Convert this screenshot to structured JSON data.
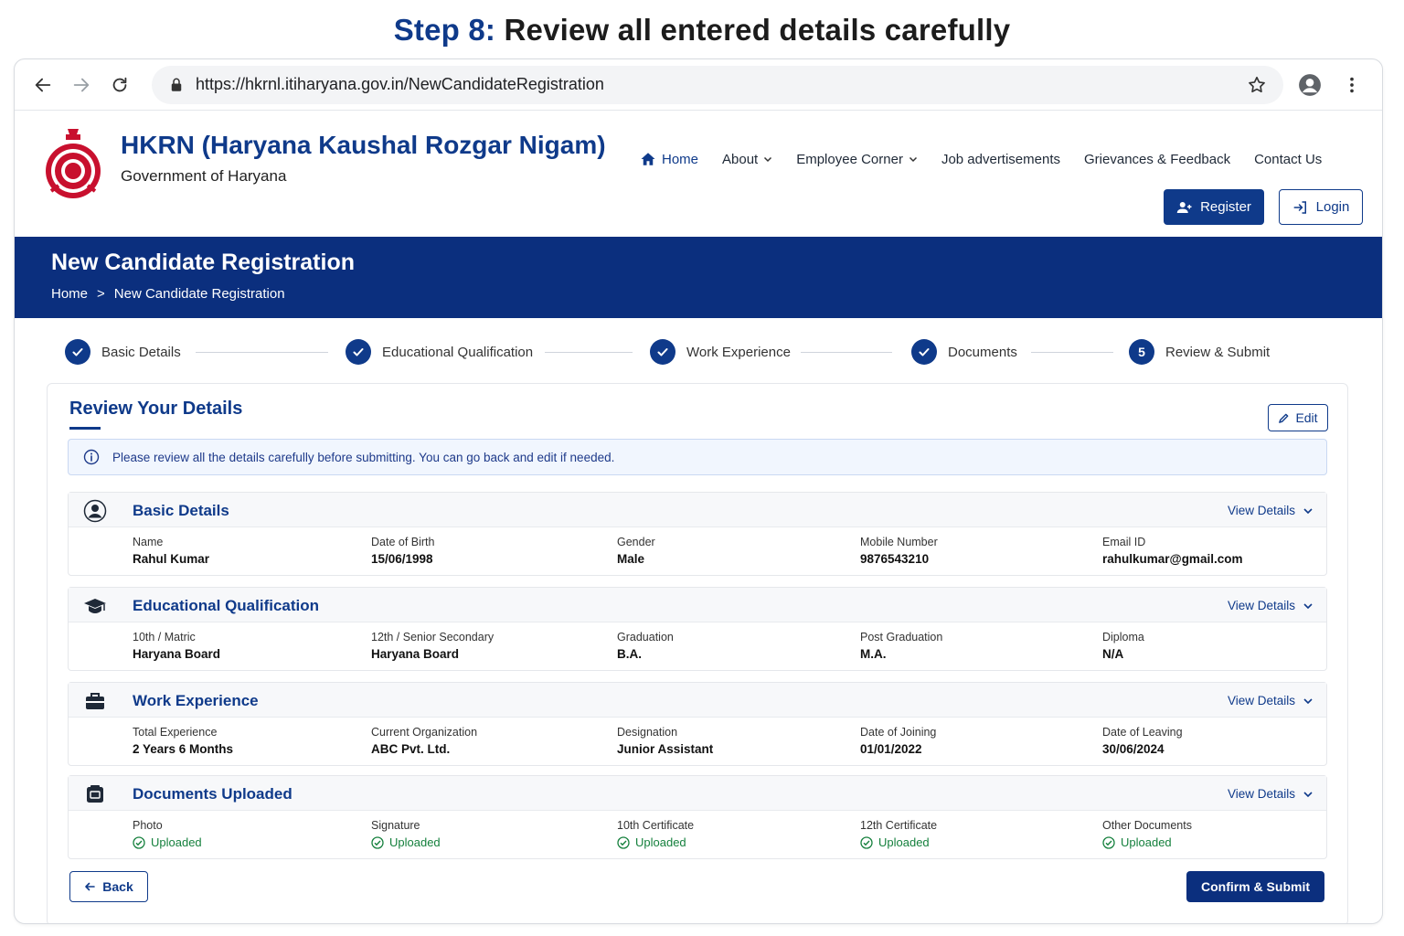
{
  "heading": {
    "step": "Step 8:",
    "text": "Review all entered details carefully"
  },
  "browser": {
    "url": "https://hkrnl.itiharyana.gov.in/NewCandidateRegistration"
  },
  "site": {
    "title": "HKRN (Haryana Kaushal Rozgar Nigam)",
    "subtitle": "Government of Haryana",
    "nav": [
      "Home",
      "About",
      "Employee Corner",
      "Job advertisements",
      "Grievances & Feedback",
      "Contact Us"
    ],
    "register_label": "Register",
    "login_label": "Login"
  },
  "banner": {
    "title": "New Candidate Registration",
    "breadcrumb": [
      "Home",
      ">",
      "New Candidate Registration"
    ]
  },
  "stepper": {
    "steps": [
      "Basic Details",
      "Educational Qualification",
      "Work Experience",
      "Documents",
      "Review & Submit"
    ],
    "current_number": "5"
  },
  "review": {
    "title": "Review Your Details",
    "edit_label": "Edit",
    "info": "Please review all the details carefully before submitting. You can go back and edit if needed.",
    "view_details_label": "View Details",
    "sections": {
      "basic": {
        "title": "Basic Details",
        "fields": [
          {
            "label": "Name",
            "value": "Rahul Kumar"
          },
          {
            "label": "Date of Birth",
            "value": "15/06/1998"
          },
          {
            "label": "Gender",
            "value": "Male"
          },
          {
            "label": "Mobile Number",
            "value": "9876543210"
          },
          {
            "label": "Email ID",
            "value": "rahulkumar@gmail.com"
          }
        ]
      },
      "education": {
        "title": "Educational Qualification",
        "fields": [
          {
            "label": "10th / Matric",
            "value": "Haryana Board"
          },
          {
            "label": "12th / Senior Secondary",
            "value": "Haryana Board"
          },
          {
            "label": "Graduation",
            "value": "B.A."
          },
          {
            "label": "Post Graduation",
            "value": "M.A."
          },
          {
            "label": "Diploma",
            "value": "N/A"
          }
        ]
      },
      "work": {
        "title": "Work Experience",
        "fields": [
          {
            "label": "Total Experience",
            "value": "2 Years 6 Months"
          },
          {
            "label": "Current Organization",
            "value": "ABC Pvt. Ltd."
          },
          {
            "label": "Designation",
            "value": "Junior Assistant"
          },
          {
            "label": "Date of Joining",
            "value": "01/01/2022"
          },
          {
            "label": "Date of Leaving",
            "value": "30/06/2024"
          }
        ]
      },
      "documents": {
        "title": "Documents Uploaded",
        "fields": [
          {
            "label": "Photo",
            "value": "Uploaded"
          },
          {
            "label": "Signature",
            "value": "Uploaded"
          },
          {
            "label": "10th Certificate",
            "value": "Uploaded"
          },
          {
            "label": "12th Certificate",
            "value": "Uploaded"
          },
          {
            "label": "Other Documents",
            "value": "Uploaded"
          }
        ]
      }
    },
    "back_label": "Back",
    "submit_label": "Confirm & Submit"
  },
  "colors": {
    "primary": "#0f3a8a",
    "banner": "#0b2f7e",
    "success": "#15803d",
    "info_bg": "#f1f6fe"
  },
  "icons": [
    "back-arrow-icon",
    "forward-arrow-icon",
    "reload-icon",
    "lock-icon",
    "star-icon",
    "profile-icon",
    "kebab-menu-icon",
    "emblem-icon",
    "home-icon",
    "chevron-down-icon",
    "add-user-icon",
    "login-icon",
    "check-icon",
    "pencil-icon",
    "info-icon",
    "user-circle-icon",
    "graduation-cap-icon",
    "briefcase-icon",
    "document-icon",
    "check-circle-icon",
    "arrow-left-icon"
  ]
}
